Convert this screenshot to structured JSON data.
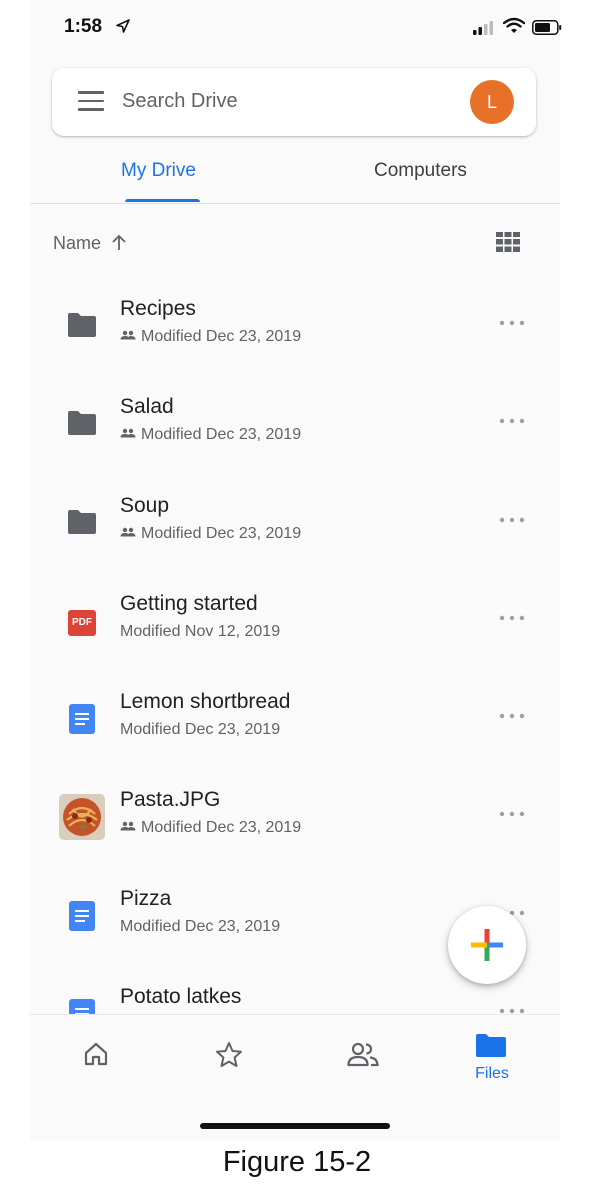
{
  "status_bar": {
    "time": "1:58"
  },
  "search": {
    "placeholder": "Search Drive",
    "avatar_initial": "L"
  },
  "tabs": [
    {
      "label": "My Drive",
      "active": true
    },
    {
      "label": "Computers",
      "active": false
    }
  ],
  "sort": {
    "label": "Name",
    "direction": "ascending"
  },
  "files": [
    {
      "name": "Recipes",
      "meta": "Modified Dec 23, 2019",
      "type": "folder",
      "shared": true,
      "icon": "folder-icon"
    },
    {
      "name": "Salad",
      "meta": "Modified Dec 23, 2019",
      "type": "folder",
      "shared": true,
      "icon": "folder-icon"
    },
    {
      "name": "Soup",
      "meta": "Modified Dec 23, 2019",
      "type": "folder",
      "shared": true,
      "icon": "folder-icon"
    },
    {
      "name": "Getting started",
      "meta": "Modified Nov 12, 2019",
      "type": "pdf",
      "shared": false,
      "icon": "pdf-icon",
      "icon_text": "PDF"
    },
    {
      "name": "Lemon shortbread",
      "meta": "Modified Dec 23, 2019",
      "type": "doc",
      "shared": false,
      "icon": "doc-icon"
    },
    {
      "name": "Pasta.JPG",
      "meta": "Modified Dec 23, 2019",
      "type": "image",
      "shared": true,
      "icon": "image-thumbnail"
    },
    {
      "name": "Pizza",
      "meta": "Modified Dec 23, 2019",
      "type": "doc",
      "shared": false,
      "icon": "doc-icon"
    },
    {
      "name": "Potato latkes",
      "meta": "",
      "type": "doc",
      "shared": false,
      "icon": "doc-icon"
    }
  ],
  "bottom_nav": [
    {
      "icon": "home-icon",
      "label": ""
    },
    {
      "icon": "star-icon",
      "label": ""
    },
    {
      "icon": "shared-people-icon",
      "label": ""
    },
    {
      "icon": "folder-icon",
      "label": "Files",
      "active": true
    }
  ],
  "caption": "Figure 15-2",
  "colors": {
    "accent": "#1a73e8",
    "avatar": "#e8712a",
    "pdf": "#db4437",
    "doc": "#4285f4",
    "folder": "#5f6368"
  }
}
